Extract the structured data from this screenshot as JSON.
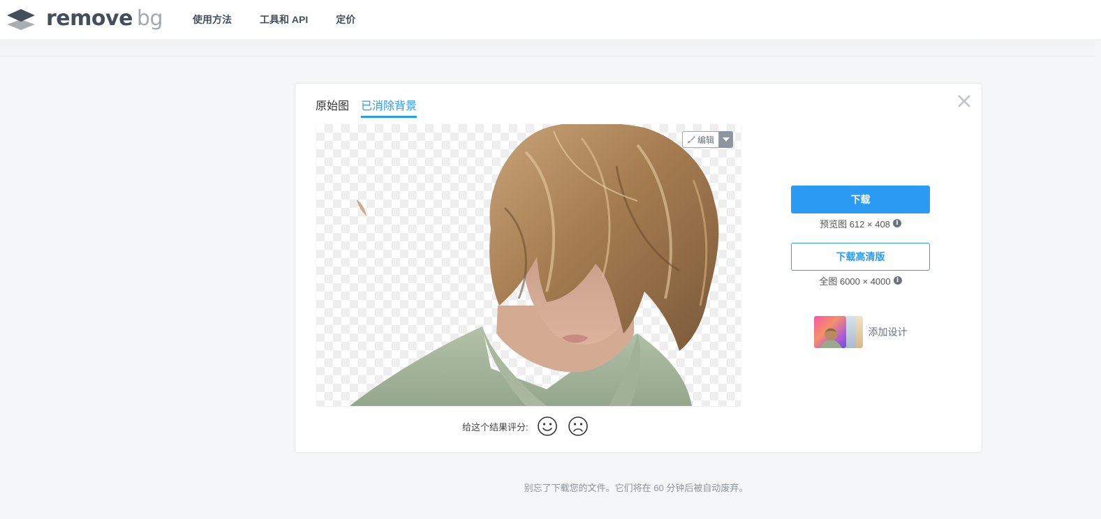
{
  "brand": {
    "name_part1": "remove",
    "name_part2": "bg",
    "logo_icon": "stacked-layers-icon"
  },
  "nav": {
    "items": [
      {
        "label": "使用方法"
      },
      {
        "label": "工具和 API"
      },
      {
        "label": "定价"
      }
    ]
  },
  "card": {
    "close_icon": "close-icon",
    "tabs": [
      {
        "label": "原始图",
        "active": false
      },
      {
        "label": "已消除背景",
        "active": true
      }
    ],
    "edit_label": "编辑",
    "edit_icon": "brush-icon",
    "rating_label": "给这个结果评分:",
    "rating_icons": [
      "smile-icon",
      "frown-icon"
    ]
  },
  "download": {
    "primary_label": "下载",
    "preview_info": "预览图 612 × 408",
    "hd_label": "下载高清版",
    "full_info": "全图 6000 × 4000",
    "design_label": "添加设计"
  },
  "footer": {
    "note": "别忘了下载您的文件。它们将在 60 分钟后被自动废弃。"
  },
  "colors": {
    "accent": "#2b9af3",
    "nav_text": "#454f5b",
    "page_bg": "#f5f6f8"
  }
}
